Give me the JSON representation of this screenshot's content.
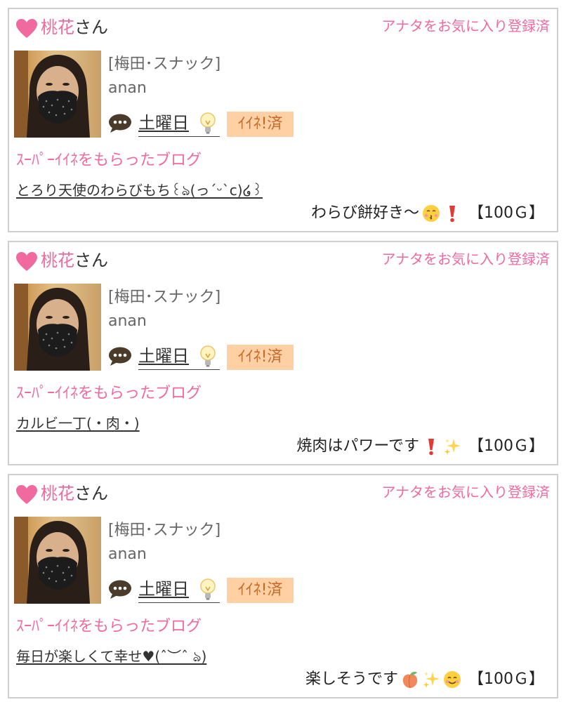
{
  "colors": {
    "accent_pink": "#f06aa0",
    "badge_bg": "#ffd0a3",
    "badge_text": "#c46a2b",
    "border": "#cfcfcf"
  },
  "cards": [
    {
      "name": "桃花",
      "honorific": "さん",
      "favorite_status": "アナタをお気に入り登録済",
      "area": "[梅田･スナック]",
      "cast_name": "anan",
      "day_link": "土曜日",
      "iine_badge": "ｲｲﾈ!済",
      "blog_label": "ｽｰﾊﾟｰｲｲﾈをもらったブログ",
      "blog_title": "とろり天使のわらびもち꒰ঌ(っˊᵕˋc)໒꒱",
      "comment": "わらび餅好き〜",
      "comment_icons": [
        "kissing-face-icon",
        "exclamation-icon"
      ],
      "amount": "【100Ｇ】"
    },
    {
      "name": "桃花",
      "honorific": "さん",
      "favorite_status": "アナタをお気に入り登録済",
      "area": "[梅田･スナック]",
      "cast_name": "anan",
      "day_link": "土曜日",
      "iine_badge": "ｲｲﾈ!済",
      "blog_label": "ｽｰﾊﾟｰｲｲﾈをもらったブログ",
      "blog_title": "カルビ一丁(・肉・)",
      "comment": "焼肉はパワーです",
      "comment_icons": [
        "exclamation-icon",
        "sparkles-icon"
      ],
      "amount": "【100Ｇ】"
    },
    {
      "name": "桃花",
      "honorific": "さん",
      "favorite_status": "アナタをお気に入り登録済",
      "area": "[梅田･スナック]",
      "cast_name": "anan",
      "day_link": "土曜日",
      "iine_badge": "ｲｲﾈ!済",
      "blog_label": "ｽｰﾊﾟｰｲｲﾈをもらったブログ",
      "blog_title": "毎日が楽しくて幸せ♥(ˆ︶ˆ ঌ)",
      "comment": "楽しそうです",
      "comment_icons": [
        "peach-icon",
        "sparkles-icon",
        "smiling-face-icon"
      ],
      "amount": "【100Ｇ】"
    }
  ]
}
